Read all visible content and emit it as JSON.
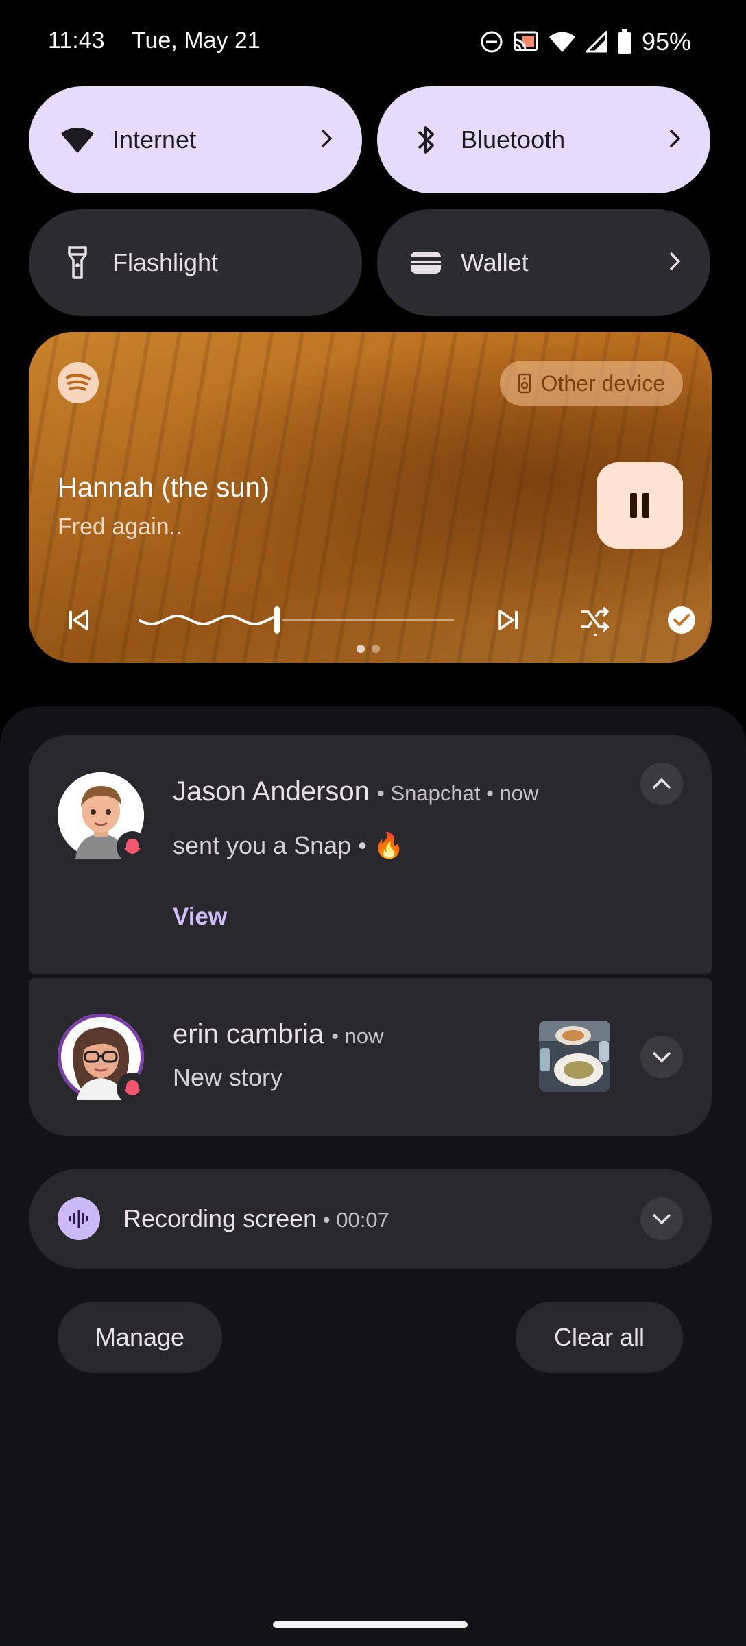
{
  "status_bar": {
    "time": "11:43",
    "date": "Tue, May 21",
    "battery": "95%",
    "icons": [
      "do-not-disturb-icon",
      "cast-icon",
      "wifi-icon",
      "signal-icon",
      "battery-icon"
    ]
  },
  "quick_settings": {
    "tiles": [
      {
        "label": "Internet",
        "icon": "wifi-icon",
        "active": true,
        "has_chevron": true
      },
      {
        "label": "Bluetooth",
        "icon": "bluetooth-icon",
        "active": true,
        "has_chevron": true
      },
      {
        "label": "Flashlight",
        "icon": "flashlight-icon",
        "active": false,
        "has_chevron": false
      },
      {
        "label": "Wallet",
        "icon": "wallet-icon",
        "active": false,
        "has_chevron": true
      }
    ]
  },
  "media": {
    "app_icon": "spotify-icon",
    "output_device": "Other device",
    "title": "Hannah (the sun)",
    "artist": "Fred again..",
    "progress_fraction": 0.44,
    "accent_color": "#c97a28",
    "page_indicator": {
      "count": 2,
      "current": 1
    }
  },
  "notifications": [
    {
      "sender": "Jason Anderson",
      "app": "Snapchat",
      "time": "now",
      "message": "sent you a Snap • 🔥",
      "action": "View",
      "expanded": true
    },
    {
      "sender": "erin cambria",
      "time": "now",
      "message": "New story",
      "expanded": false
    }
  ],
  "recording": {
    "title": "Recording screen",
    "elapsed": "00:07"
  },
  "footer": {
    "manage_label": "Manage",
    "clear_label": "Clear all"
  },
  "colors": {
    "tile_active": "#e4dcfa",
    "tile_inactive": "#2c2b30",
    "card_bg": "#29282d",
    "action_text": "#cfbdfe"
  }
}
